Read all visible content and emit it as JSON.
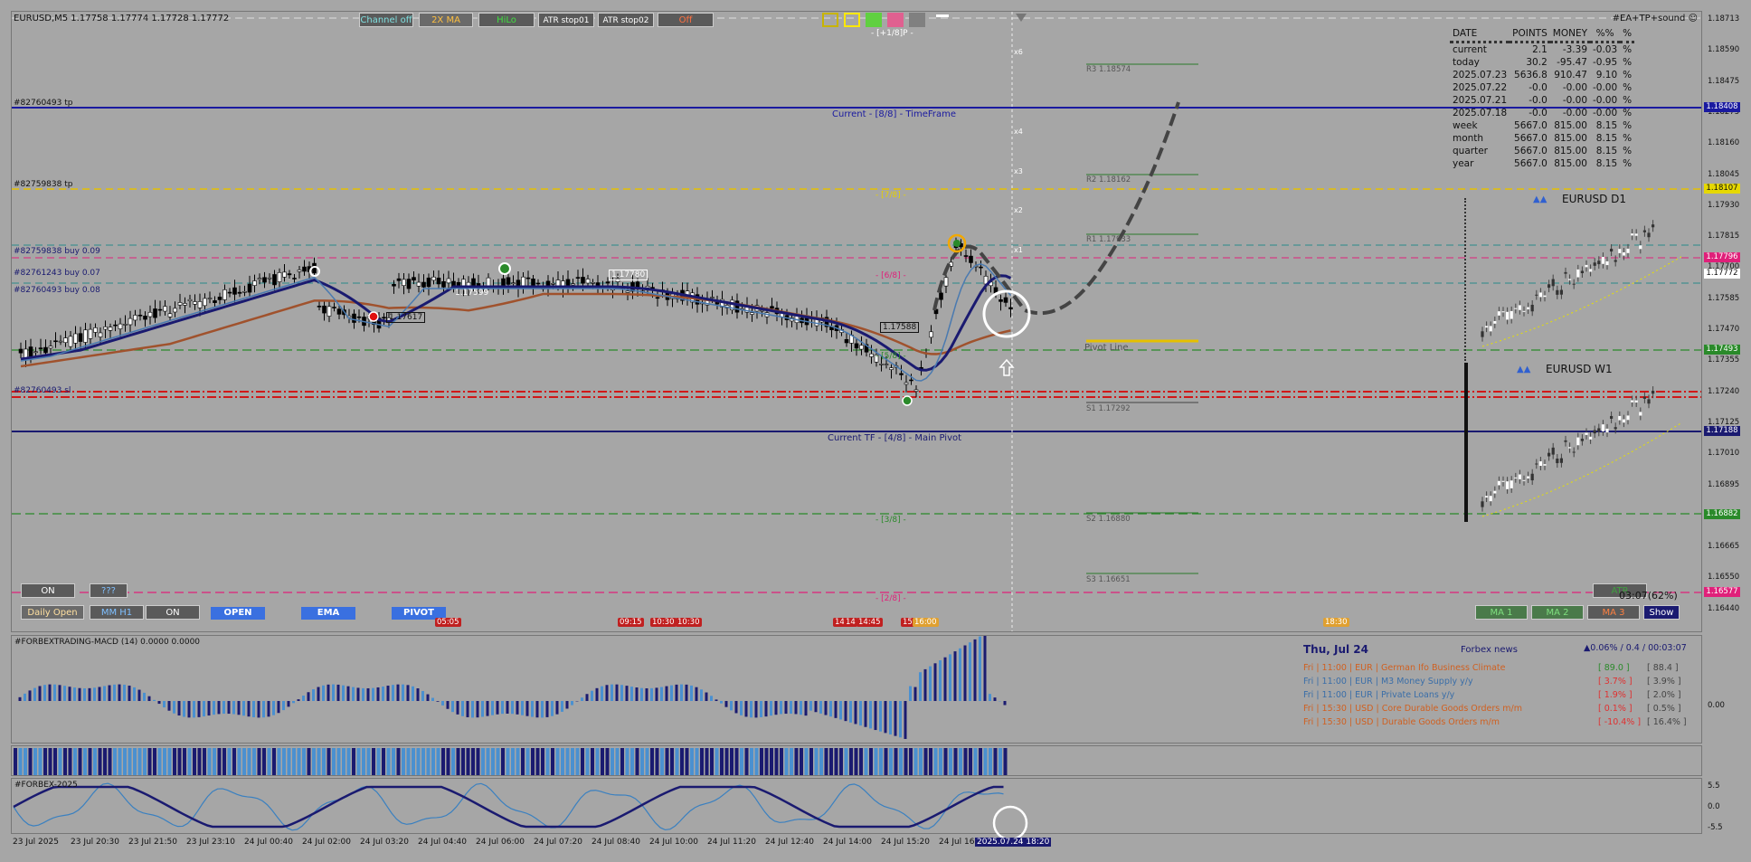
{
  "header": {
    "symbol_info": "EURUSD,M5  1.17758 1.17774 1.17728 1.17772",
    "ea_title": "#EA+TP+sound",
    "smiley": "☺",
    "fraction_label": "- [+1/8]P -"
  },
  "toolbar": {
    "channel_off": "Channel off",
    "two_ma": "2X MA",
    "hilo": "HiLo",
    "atr_stop01": "ATR stop01",
    "atr_stop02": "ATR stop02",
    "off": "Off"
  },
  "trade_labels": {
    "tp1": "#82760493 tp",
    "tp2": "#82759838 tp",
    "buy1": "#82759838 buy 0.09",
    "buy2": "#82761243 buy 0.07",
    "buy3": "#82760493 buy 0.08",
    "sl": "#82760493 sl"
  },
  "murrey": {
    "current_8_8": "Current - [8/8] - TimeFrame",
    "m7_8": "- [7/8] -",
    "m6_8": "- [6/8] -",
    "m5_8": "- [5/8] -",
    "main_pivot": "Current TF - [4/8] - Main Pivot",
    "m3_8": "- [3/8] -",
    "m2_8": "- [2/8] -"
  },
  "pivots": {
    "r3": "R3 1.18574",
    "r2": "R2 1.18162",
    "r1": "R1 1.17933",
    "pivot": "Pivot Line",
    "s1": "S1 1.17292",
    "s2": "S2 1.16880",
    "s3": "S3 1.16651"
  },
  "price_labels": {
    "p1": "1.17617",
    "p2": "1.17588",
    "p3": "1.17599",
    "p4": "1.17780"
  },
  "level_marks": [
    "x6",
    "x4",
    "x3",
    "x2",
    "x1"
  ],
  "stats": {
    "headers": [
      "DATE",
      "POINTS",
      "MONEY",
      "%%",
      "%"
    ],
    "rows": [
      {
        "date": "current",
        "points": "2.1",
        "money": "-3.39",
        "pct": "-0.03",
        "unit": "%"
      },
      {
        "date": "today",
        "points": "30.2",
        "money": "-95.47",
        "pct": "-0.95",
        "unit": "%"
      },
      {
        "date": "2025.07.23",
        "points": "5636.8",
        "money": "910.47",
        "pct": "9.10",
        "unit": "%"
      },
      {
        "date": "2025.07.22",
        "points": "-0.0",
        "money": "-0.00",
        "pct": "-0.00",
        "unit": "%"
      },
      {
        "date": "2025.07.21",
        "points": "-0.0",
        "money": "-0.00",
        "pct": "-0.00",
        "unit": "%"
      },
      {
        "date": "2025.07.18",
        "points": "-0.0",
        "money": "-0.00",
        "pct": "-0.00",
        "unit": "%"
      },
      {
        "date": "week",
        "points": "5667.0",
        "money": "815.00",
        "pct": "8.15",
        "unit": "%"
      },
      {
        "date": "month",
        "points": "5667.0",
        "money": "815.00",
        "pct": "8.15",
        "unit": "%"
      },
      {
        "date": "quarter",
        "points": "5667.0",
        "money": "815.00",
        "pct": "8.15",
        "unit": "%"
      },
      {
        "date": "year",
        "points": "5667.0",
        "money": "815.00",
        "pct": "8.15",
        "unit": "%"
      }
    ]
  },
  "mini_charts": {
    "d1": "EURUSD  D1",
    "w1": "EURUSD  W1",
    "arrows": "▲▲"
  },
  "yaxis": {
    "ticks": [
      "1.18713",
      "1.18590",
      "1.18475",
      "1.18275",
      "1.18160",
      "1.18045",
      "1.17930",
      "1.17815",
      "1.17700",
      "1.17585",
      "1.17470",
      "1.17355",
      "1.17240",
      "1.17125",
      "1.17010",
      "1.16895",
      "1.16780",
      "1.16665",
      "1.16550",
      "1.16440"
    ],
    "boxes": [
      {
        "text": "1.18408",
        "bg": "#1a1aa0",
        "fg": "#ffffff"
      },
      {
        "text": "1.18107",
        "bg": "#e6d800",
        "fg": "#111111"
      },
      {
        "text": "1.17796",
        "bg": "#e0207a",
        "fg": "#ffffff"
      },
      {
        "text": "1.17772",
        "bg": "#ffffff",
        "fg": "#111111"
      },
      {
        "text": "1.17493",
        "bg": "#2a8a2a",
        "fg": "#ffffff"
      },
      {
        "text": "1.17188",
        "bg": "#1a1a70",
        "fg": "#ffffff"
      },
      {
        "text": "1.16882",
        "bg": "#2a8a2a",
        "fg": "#ffffff"
      },
      {
        "text": "1.16577",
        "bg": "#e0207a",
        "fg": "#ffffff"
      }
    ]
  },
  "bottom_buttons": {
    "on1": "ON",
    "ttt": "???",
    "daily_open": "Daily Open",
    "mm_h1": "MM H1",
    "on2": "ON",
    "open": "OPEN",
    "ema": "EMA",
    "pivot": "PIVOT",
    "atr": "ATR",
    "countdown": "03:07(62%)",
    "ma1": "MA 1",
    "ma2": "MA 2",
    "ma3": "MA 3",
    "show": "Show"
  },
  "news_tags": [
    "05:05",
    "09:15",
    "10:30",
    "10:30",
    "14",
    "14",
    "14:45",
    "15",
    "16:00",
    "18:30"
  ],
  "macd": {
    "title": "#FORBEXTRADING-MACD (14) 0.0000 0.0000",
    "y_zero": "0.00"
  },
  "forbex": {
    "title": "#FORBEX-2025",
    "y_top": "5.5",
    "y_mid": "0.0",
    "y_bot": "-5.5"
  },
  "news": {
    "date": "Thu, Jul 24",
    "source": "Forbex news",
    "stats": "▲0.06% / 0.4 / 00:03:07",
    "items": [
      {
        "text": "Fri  |  11:00  |  EUR  |  German Ifo Business Climate",
        "actual": "[ 89.0 ]",
        "prev": "[ 88.4 ]",
        "color": "#d06020"
      },
      {
        "text": "Fri  |  11:00  |  EUR  |  M3 Money Supply y/y",
        "actual": "[ 3.7% ]",
        "prev": "[ 3.9% ]",
        "color": "#3a6ea8"
      },
      {
        "text": "Fri  |  11:00  |  EUR  |  Private Loans y/y",
        "actual": "[ 1.9% ]",
        "prev": "[ 2.0% ]",
        "color": "#3a6ea8"
      },
      {
        "text": "Fri  |  15:30  |  USD  |  Core Durable Goods Orders m/m",
        "actual": "[ 0.1% ]",
        "prev": "[ 0.5% ]",
        "color": "#d06020"
      },
      {
        "text": "Fri  |  15:30  |  USD  |  Durable Goods Orders m/m",
        "actual": "[ -10.4% ]",
        "prev": "[ 16.4% ]",
        "color": "#d06020"
      }
    ]
  },
  "xaxis": {
    "labels": [
      "23 Jul 2025",
      "23 Jul 20:30",
      "23 Jul 21:50",
      "23 Jul 23:10",
      "24 Jul 00:40",
      "24 Jul 02:00",
      "24 Jul 03:20",
      "24 Jul 04:40",
      "24 Jul 06:00",
      "24 Jul 07:20",
      "24 Jul 08:40",
      "24 Jul 10:00",
      "24 Jul 11:20",
      "24 Jul 12:40",
      "24 Jul 14:00",
      "24 Jul 15:20",
      "24 Jul 16:",
      "2025.07.24 18:20"
    ]
  }
}
